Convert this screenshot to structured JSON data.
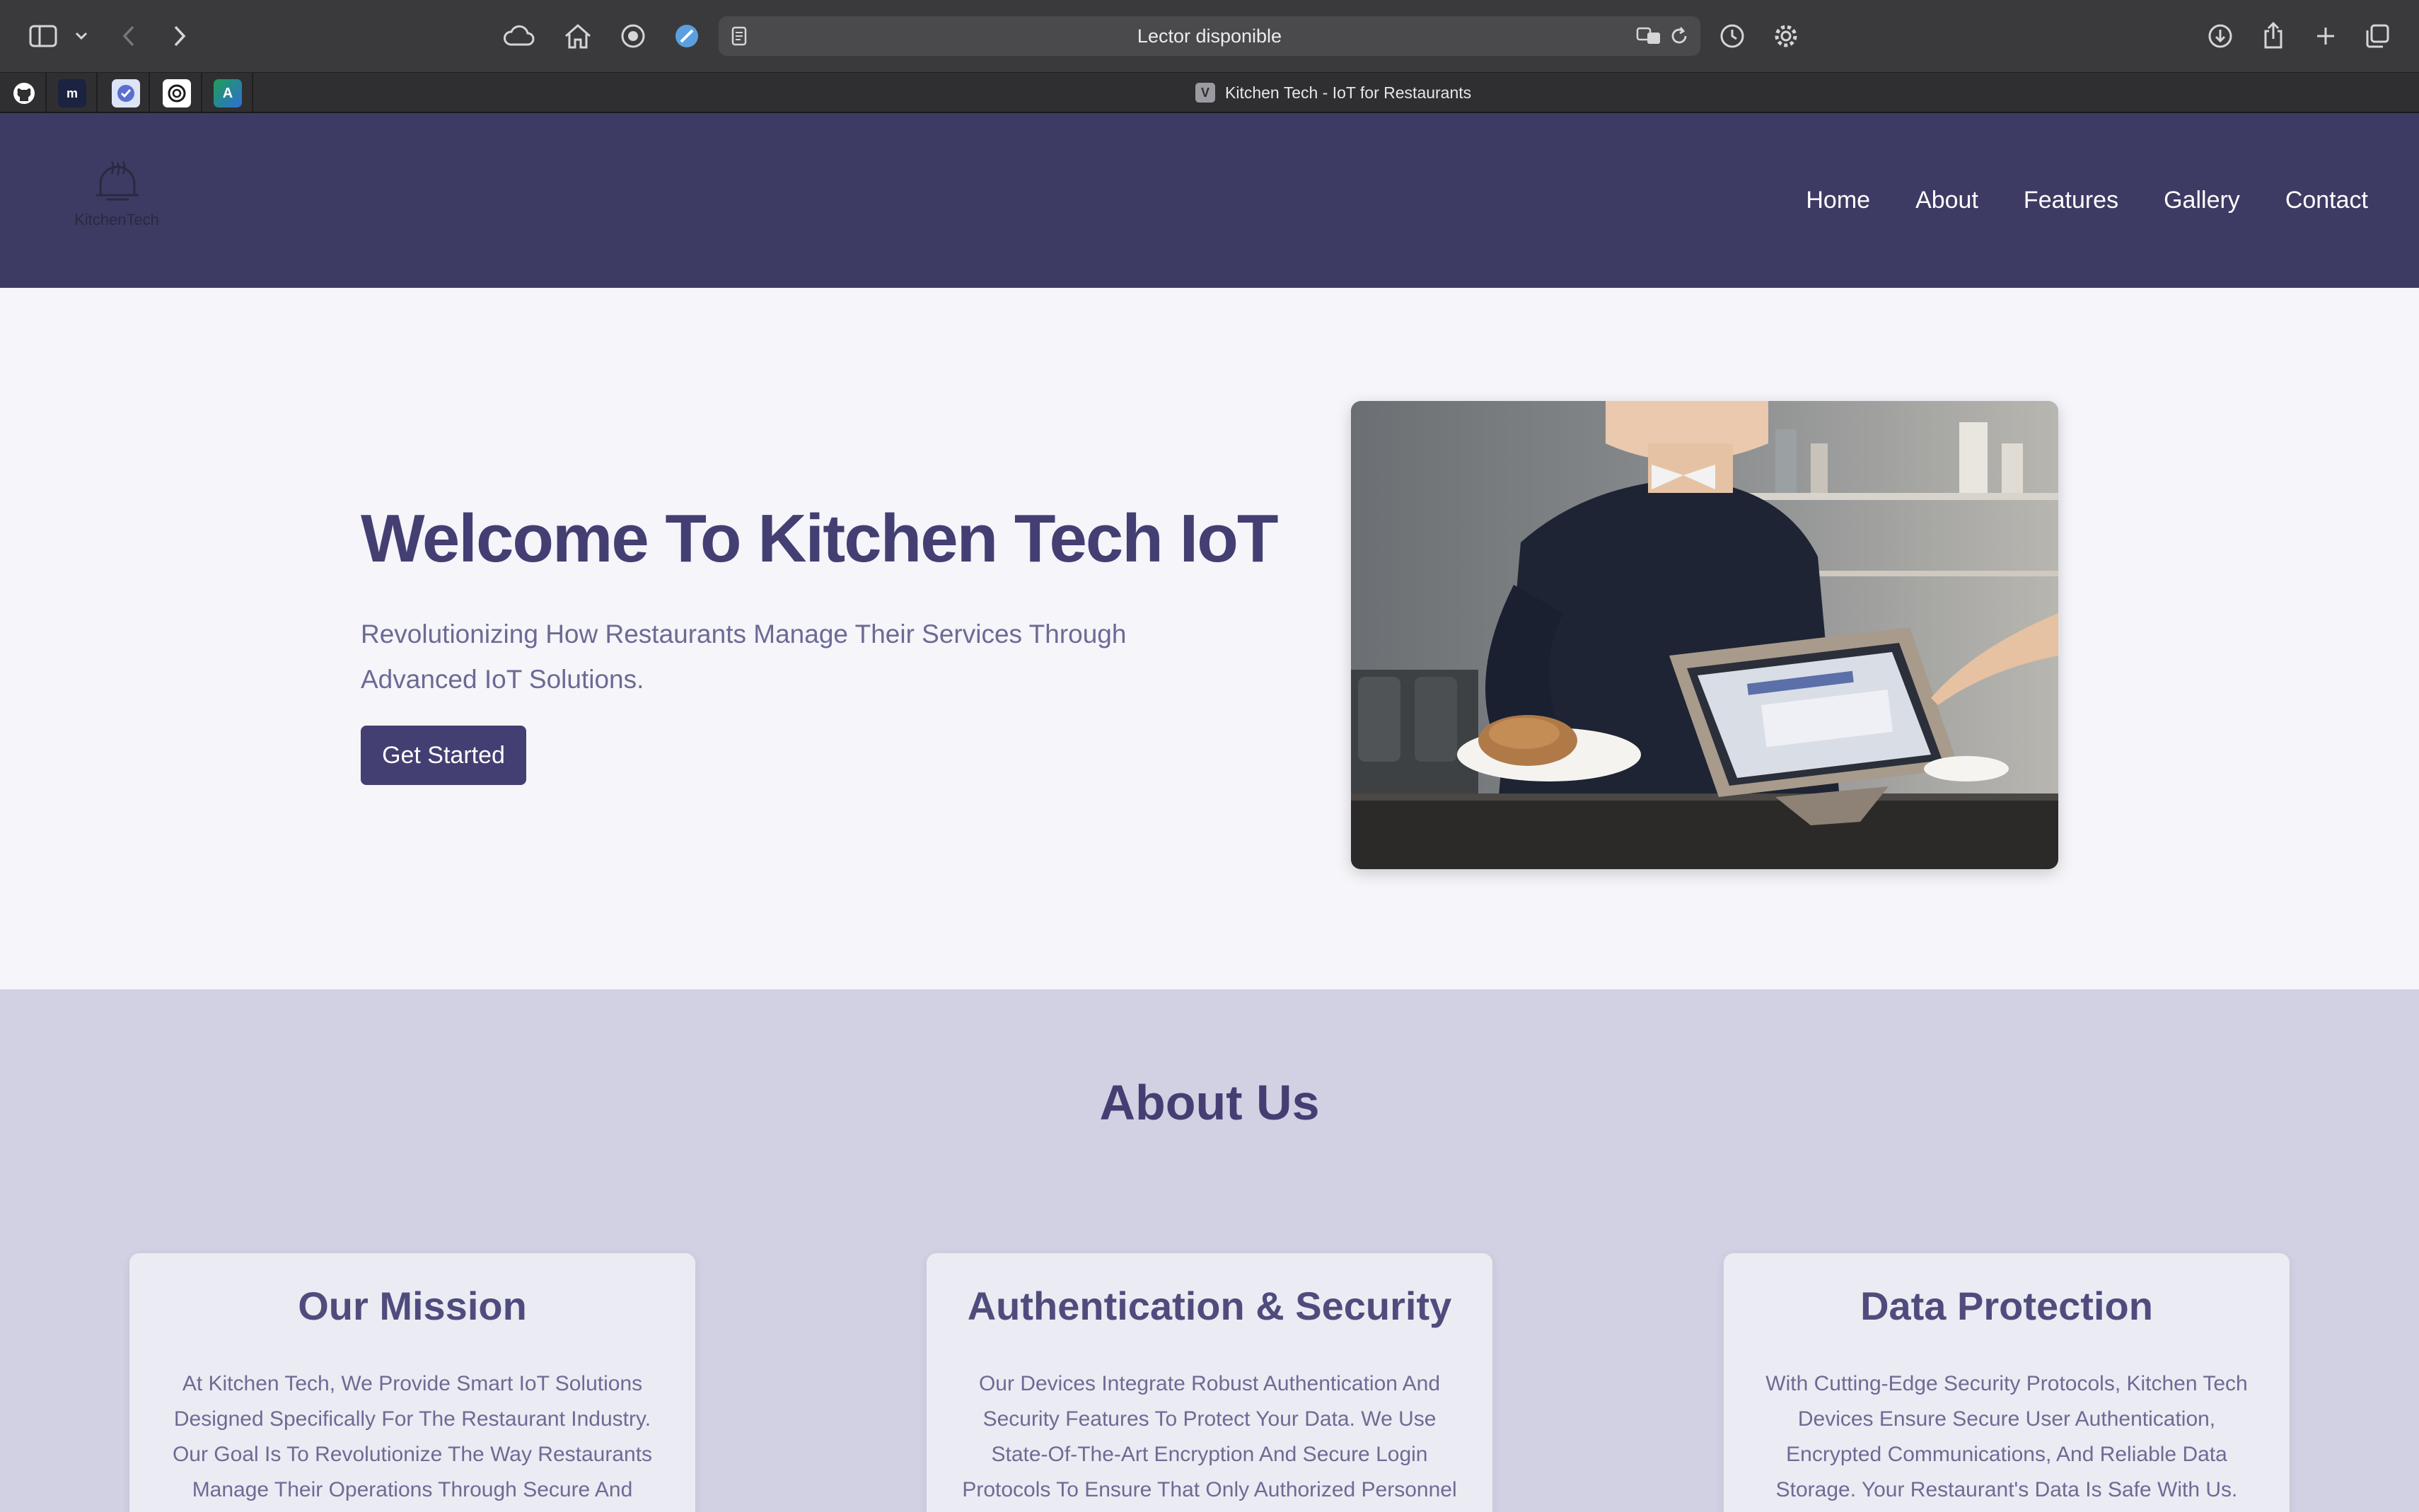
{
  "browser": {
    "address_text": "Lector disponible",
    "tab_title": "Kitchen Tech - IoT for Restaurants",
    "tab_favicon_letter": "V",
    "favorites": [
      {
        "name": "github",
        "letter": ""
      },
      {
        "name": "m",
        "letter": "m"
      },
      {
        "name": "shield",
        "letter": ""
      },
      {
        "name": "openai",
        "letter": ""
      },
      {
        "name": "a",
        "letter": "A"
      }
    ]
  },
  "site": {
    "logo_text": "KitchenTech",
    "nav": [
      "Home",
      "About",
      "Features",
      "Gallery",
      "Contact"
    ]
  },
  "hero": {
    "title": "Welcome To Kitchen Tech IoT",
    "subtitle": "Revolutionizing How Restaurants Manage Their Services Through Advanced IoT Solutions.",
    "cta": "Get Started"
  },
  "about": {
    "title": "About Us",
    "cards": [
      {
        "title": "Our Mission",
        "text": "At Kitchen Tech, We Provide Smart IoT Solutions Designed Specifically For The Restaurant Industry. Our Goal Is To Revolutionize The Way Restaurants Manage Their Operations Through Secure And Efficient IoT Devices."
      },
      {
        "title": "Authentication & Security",
        "text": "Our Devices Integrate Robust Authentication And Security Features To Protect Your Data. We Use State-Of-The-Art Encryption And Secure Login Protocols To Ensure That Only Authorized Personnel Have Access To Sensitive Information."
      },
      {
        "title": "Data Protection",
        "text": "With Cutting-Edge Security Protocols, Kitchen Tech Devices Ensure Secure User Authentication, Encrypted Communications, And Reliable Data Storage. Your Restaurant's Data Is Safe With Us."
      }
    ]
  },
  "colors": {
    "header_bg": "#3d3b63",
    "primary": "#433f72",
    "about_bg": "#d1d1e3"
  }
}
